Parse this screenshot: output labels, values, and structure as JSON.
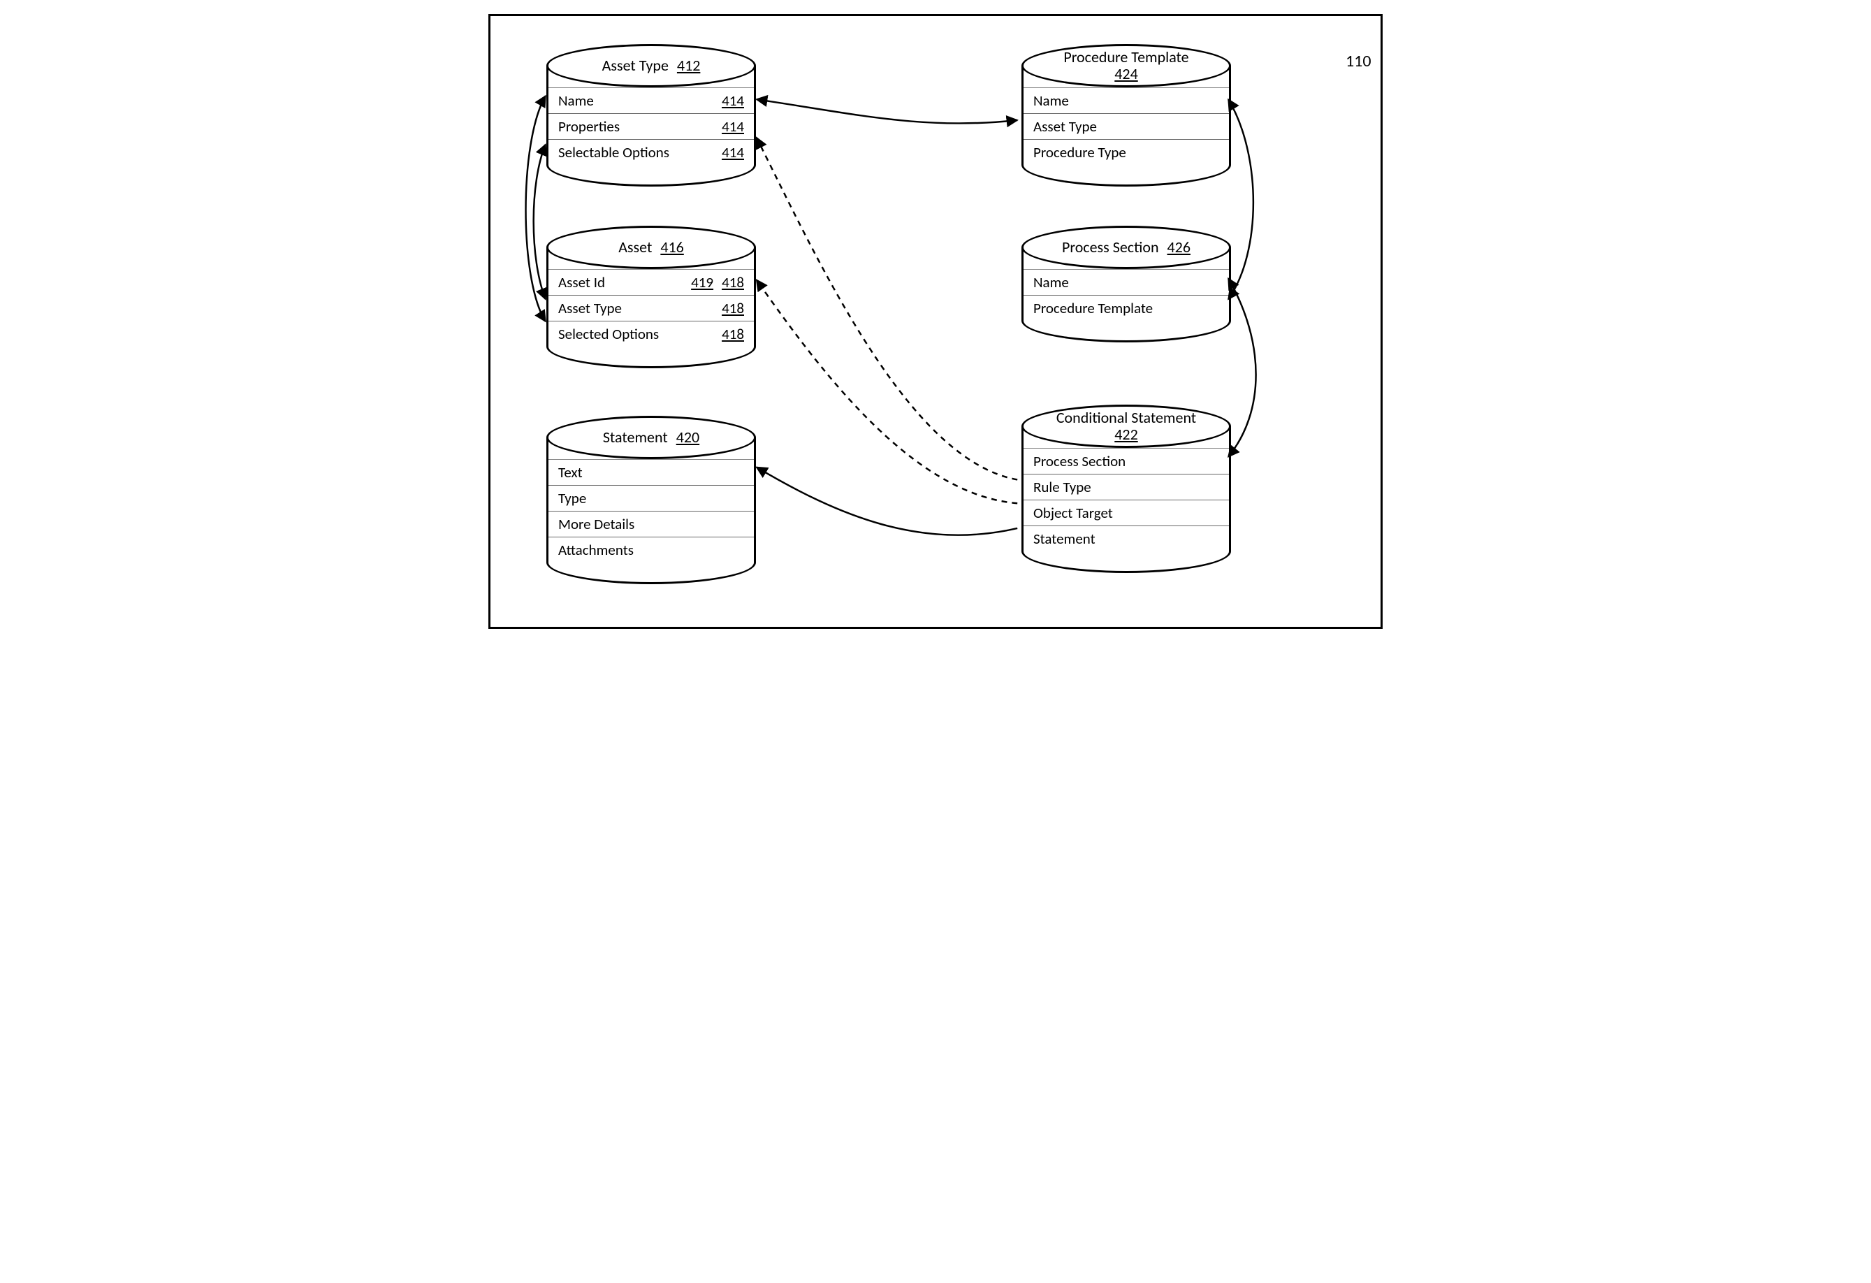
{
  "outer_label": "110",
  "entities": {
    "asset_type": {
      "title": "Asset Type",
      "ref": "412",
      "rows": [
        {
          "label": "Name",
          "refs": [
            "414"
          ]
        },
        {
          "label": "Properties",
          "refs": [
            "414"
          ]
        },
        {
          "label": "Selectable Options",
          "refs": [
            "414"
          ]
        }
      ]
    },
    "asset": {
      "title": "Asset",
      "ref": "416",
      "rows": [
        {
          "label": "Asset Id",
          "refs": [
            "419",
            "418"
          ]
        },
        {
          "label": "Asset Type",
          "refs": [
            "418"
          ]
        },
        {
          "label": "Selected Options",
          "refs": [
            "418"
          ]
        }
      ]
    },
    "statement": {
      "title": "Statement",
      "ref": "420",
      "rows": [
        {
          "label": "Text",
          "refs": []
        },
        {
          "label": "Type",
          "refs": []
        },
        {
          "label": "More Details",
          "refs": []
        },
        {
          "label": "Attachments",
          "refs": []
        }
      ]
    },
    "procedure_template": {
      "title": "Procedure Template",
      "ref": "424",
      "rows": [
        {
          "label": "Name",
          "refs": []
        },
        {
          "label": "Asset Type",
          "refs": []
        },
        {
          "label": "Procedure Type",
          "refs": []
        }
      ]
    },
    "process_section": {
      "title": "Process Section",
      "ref": "426",
      "rows": [
        {
          "label": "Name",
          "refs": []
        },
        {
          "label": "Procedure Template",
          "refs": []
        }
      ]
    },
    "conditional_statement": {
      "title": "Conditional Statement",
      "ref": "422",
      "rows": [
        {
          "label": "Process Section",
          "refs": []
        },
        {
          "label": "Rule Type",
          "refs": []
        },
        {
          "label": "Object Target",
          "refs": []
        },
        {
          "label": "Statement",
          "refs": []
        }
      ]
    }
  }
}
